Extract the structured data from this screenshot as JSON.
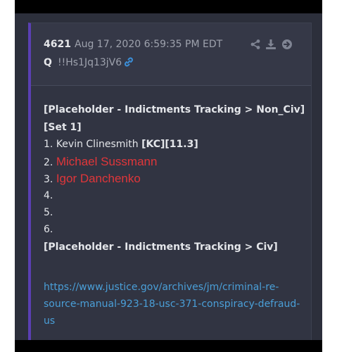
{
  "post": {
    "number": "4621",
    "date": "Aug 17, 2020 6:59:35 PM EDT",
    "author": "Q",
    "tripcode": "!!Hs1Jq13jV6",
    "icons": {
      "permalink": "link-icon",
      "share": "share-icon",
      "download": "download-icon",
      "navigate": "arrow-circle-right-icon"
    }
  },
  "body": {
    "heading": "[Placeholder - Indictments Tracking > Non_Civ]",
    "set": "[Set 1]",
    "items": [
      {
        "num": "1.",
        "name": "Kevin Clinesmith",
        "tag": "[KC][11.3]"
      },
      {
        "num": "2.",
        "name": "Michael Sussmann"
      },
      {
        "num": "3.",
        "name": "Igor Danchenko"
      },
      {
        "num": "4.",
        "name": ""
      },
      {
        "num": "5.",
        "name": ""
      },
      {
        "num": "6.",
        "name": ""
      }
    ],
    "footer_heading": "[Placeholder - Indictments Tracking > Civ]",
    "url_lines": [
      "https://www.justice.gov/archives/jm/criminal-re-",
      "source-manual-923-18-usc-371-conspiracy-defraud-",
      "us"
    ]
  },
  "colors": {
    "accent_border": "#5b3fb3",
    "highlight_red": "#e0363a",
    "link_blue": "#4a9fd8",
    "card_bg": "#313442"
  }
}
